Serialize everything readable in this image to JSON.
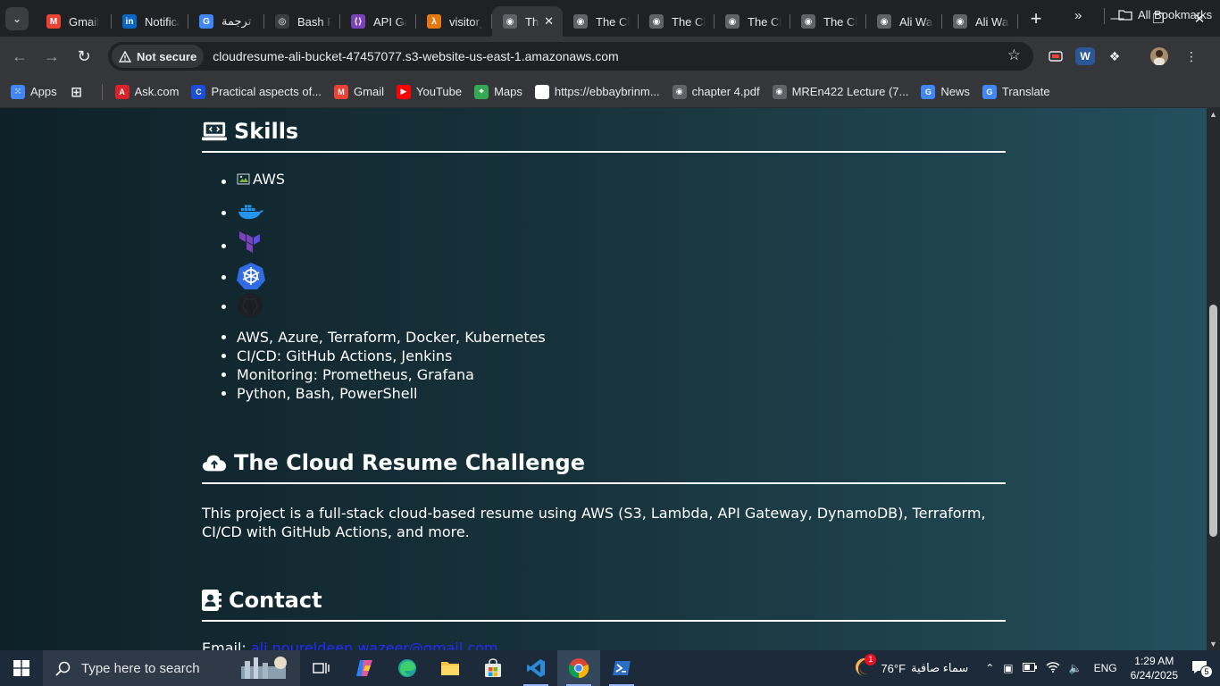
{
  "browser": {
    "tabs": [
      {
        "title": "Gmail",
        "icon": "gmail-icon",
        "color": "#ea4335",
        "glyph": "M"
      },
      {
        "title": "Notifica",
        "icon": "linkedin-icon",
        "color": "#0a66c2",
        "glyph": "in"
      },
      {
        "title": "ترجمة e",
        "icon": "google-translate-icon",
        "color": "#4285f4",
        "glyph": "G"
      },
      {
        "title": "Bash Pr",
        "icon": "chatgpt-icon",
        "color": "#3c3d40",
        "glyph": "◎"
      },
      {
        "title": "API Gat",
        "icon": "api-gateway-icon",
        "color": "#7b42bc",
        "glyph": "⟨⟩"
      },
      {
        "title": "visitor_",
        "icon": "lambda-icon",
        "color": "#e47911",
        "glyph": "λ"
      },
      {
        "title": "Th",
        "icon": "globe-icon",
        "color": "#5f6368",
        "glyph": "◉",
        "active": true
      },
      {
        "title": "The Clo",
        "icon": "globe-icon",
        "color": "#5f6368",
        "glyph": "◉"
      },
      {
        "title": "The Clo",
        "icon": "globe-icon",
        "color": "#5f6368",
        "glyph": "◉"
      },
      {
        "title": "The Clo",
        "icon": "globe-icon",
        "color": "#5f6368",
        "glyph": "◉"
      },
      {
        "title": "The Clo",
        "icon": "globe-icon",
        "color": "#5f6368",
        "glyph": "◉"
      },
      {
        "title": "Ali Waz",
        "icon": "globe-icon",
        "color": "#5f6368",
        "glyph": "◉"
      },
      {
        "title": "Ali Waz",
        "icon": "globe-icon",
        "color": "#5f6368",
        "glyph": "◉"
      }
    ],
    "security_label": "Not secure",
    "url": "cloudresume-ali-bucket-47457077.s3-website-us-east-1.amazonaws.com",
    "bookmarks": [
      {
        "label": "Apps",
        "icon": "apps-grid-icon",
        "color": "#4285f4",
        "glyph": "⁙"
      },
      {
        "label": "",
        "icon": "tab-groups-icon",
        "color": "#35363a",
        "glyph": "⊞"
      },
      {
        "label": "Ask.com",
        "icon": "ask-icon",
        "color": "#d8232a",
        "glyph": "A"
      },
      {
        "label": "Practical aspects of...",
        "icon": "coursera-icon",
        "color": "#1c4ed8",
        "glyph": "C"
      },
      {
        "label": "Gmail",
        "icon": "gmail-icon",
        "color": "#ea4335",
        "glyph": "M"
      },
      {
        "label": "YouTube",
        "icon": "youtube-icon",
        "color": "#ff0000",
        "glyph": "▶"
      },
      {
        "label": "Maps",
        "icon": "maps-icon",
        "color": "#34a853",
        "glyph": "⌖"
      },
      {
        "label": "https://ebbaybrinm...",
        "icon": "page-icon",
        "color": "#ffffff",
        "glyph": ""
      },
      {
        "label": "chapter 4.pdf",
        "icon": "globe-icon",
        "color": "#5f6368",
        "glyph": "◉"
      },
      {
        "label": "MREn422 Lecture (7...",
        "icon": "globe-icon",
        "color": "#5f6368",
        "glyph": "◉"
      },
      {
        "label": "News",
        "icon": "google-news-icon",
        "color": "#4285f4",
        "glyph": "G"
      },
      {
        "label": "Translate",
        "icon": "google-translate-icon",
        "color": "#4285f4",
        "glyph": "G"
      }
    ],
    "all_bookmarks_label": "All Bookmarks"
  },
  "page": {
    "skills_heading": "Skills",
    "logo_alt_aws": "AWS",
    "logos": [
      "docker-logo",
      "terraform-logo",
      "kubernetes-logo",
      "github-logo"
    ],
    "skills": [
      "AWS, Azure, Terraform, Docker, Kubernetes",
      "CI/CD: GitHub Actions, Jenkins",
      "Monitoring: Prometheus, Grafana",
      "Python, Bash, PowerShell"
    ],
    "challenge_heading": "The Cloud Resume Challenge",
    "challenge_text": "This project is a full-stack cloud-based resume using AWS (S3, Lambda, API Gateway, DynamoDB), Terraform, CI/CD with GitHub Actions, and more.",
    "contact_heading": "Contact",
    "email_label": "Email:",
    "email_value": "ali.noureldeen.wazeer@gmail.com"
  },
  "taskbar": {
    "search_placeholder": "Type here to search",
    "weather_temp": "76°F",
    "weather_text": "سماء صافية",
    "weather_badge": "1",
    "lang": "ENG",
    "time": "1:29 AM",
    "date": "6/24/2025",
    "notification_count": "5"
  },
  "colors": {
    "accent": "#2929ff",
    "page_bg_left": "#0e2128",
    "page_bg_right": "#244f5c"
  }
}
